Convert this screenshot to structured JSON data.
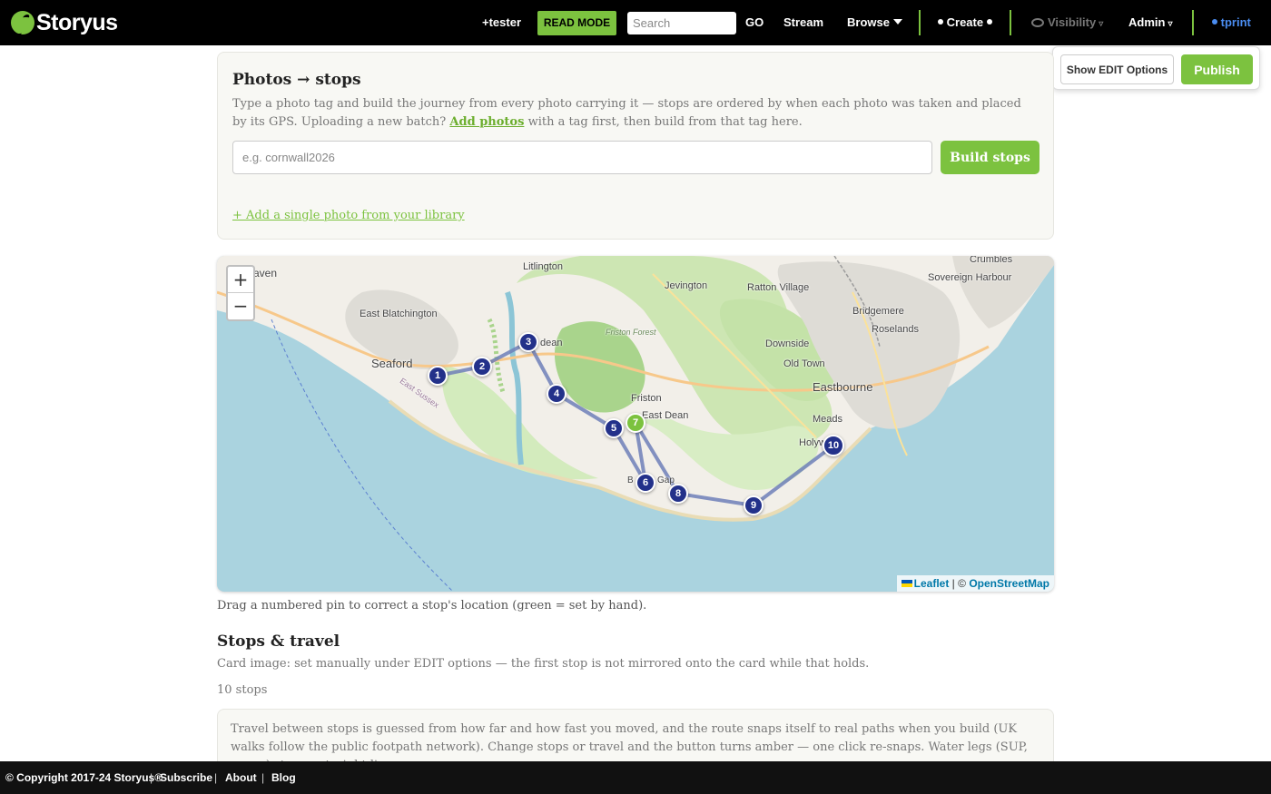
{
  "navbar": {
    "logo_text": "Storyus",
    "user_tag": "+tester",
    "read_mode": "READ MODE",
    "search_placeholder": "Search",
    "go": "GO",
    "stream": "Stream",
    "browse": "Browse",
    "create": "Create",
    "visibility": "Visibility",
    "admin": "Admin",
    "user": "tprint",
    "accent_color": "#7cc23f"
  },
  "edit_panel": {
    "show_edit": "Show EDIT Options",
    "publish": "Publish"
  },
  "photo_card": {
    "title": "Photos → stops",
    "desc_1": "Type a photo tag and build the journey from every photo carrying it — stops are ordered by when each photo was taken and placed by its GPS. Uploading a new batch?",
    "add_photos": "Add photos",
    "desc_2": "with a tag first, then build from that tag here.",
    "tag_placeholder": "e.g. cornwall2026",
    "build_button": "Build stops",
    "add_single": "+ Add a single photo from your library"
  },
  "map": {
    "zoom_in": "+",
    "zoom_out": "−",
    "labels": {
      "haven": "aven",
      "litlington": "Litlington",
      "jevington": "Jevington",
      "ratton": "Ratton Village",
      "crumbles": "Crumbles",
      "sovereign": "Sovereign Harbour",
      "east_blatchington": "East Blatchington",
      "bridgemere": "Bridgemere",
      "roselands": "Roselands",
      "friston_forest": "Friston Forest",
      "dean": "dean",
      "downside": "Downside",
      "old_town": "Old Town",
      "seaford": "Seaford",
      "east_sussex": "East Sussex",
      "eastbourne": "Eastbourne",
      "friston": "Friston",
      "east_dean": "East Dean",
      "meads": "Meads",
      "holywell": "Holyw",
      "birling_b": "B",
      "gap": "Gap"
    },
    "pins": [
      {
        "n": "1",
        "manual": false
      },
      {
        "n": "2",
        "manual": false
      },
      {
        "n": "3",
        "manual": false
      },
      {
        "n": "4",
        "manual": false
      },
      {
        "n": "5",
        "manual": false
      },
      {
        "n": "6",
        "manual": false
      },
      {
        "n": "7",
        "manual": true
      },
      {
        "n": "8",
        "manual": false
      },
      {
        "n": "9",
        "manual": false
      },
      {
        "n": "10",
        "manual": false
      }
    ],
    "attribution_leaflet": "Leaflet",
    "attribution_sep": "| ©",
    "attribution_osm": "OpenStreetMap",
    "route_color": "#6f7fb8",
    "pin_color": "#23318a",
    "manual_pin_color": "#7cc23f"
  },
  "hint": "Drag a numbered pin to correct a stop's location (green = set by hand).",
  "stops": {
    "title": "Stops & travel",
    "card_image_note": "Card image: set manually under EDIT options — the first stop is not mirrored onto the card while that holds.",
    "count": "10 stops",
    "travel_text": "Travel between stops is guessed from how far and how fast you moved, and the route snaps itself to real paths when you build (UK walks follow the public footpath network). Change stops or travel and the button turns amber — one click re-snaps. Water legs (SUP, canoe) stay as straight lines on"
  },
  "footer": {
    "copyright": "© Copyright 2017-24 Storyus®",
    "sep": "|",
    "subscribe": "Subscribe",
    "about": "About",
    "blog": "Blog"
  }
}
